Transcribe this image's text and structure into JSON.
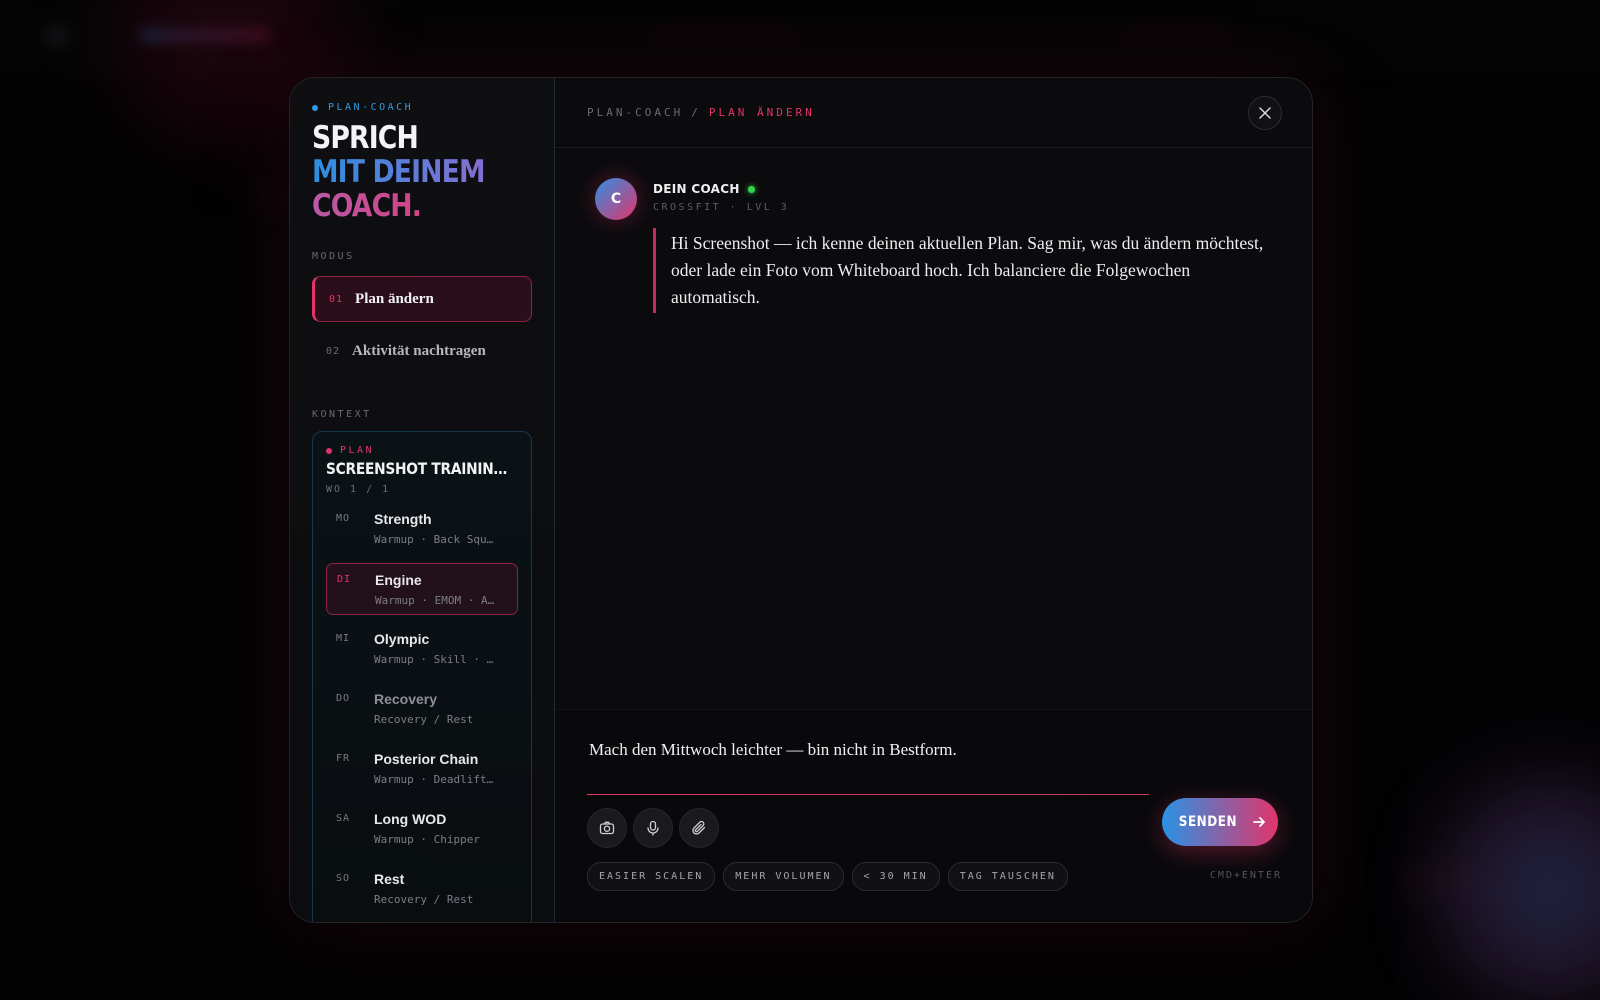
{
  "modal": {
    "eyebrow": "PLAN-COACH",
    "headline": {
      "line1": "SPRICH",
      "line2": "MIT DEINEM",
      "line3": "COACH."
    },
    "modus_label": "MODUS",
    "modes": [
      {
        "num": "01",
        "label": "Plan ändern",
        "active": true
      },
      {
        "num": "02",
        "label": "Aktivität nachtragen",
        "active": false
      }
    ],
    "kontext_label": "KONTEXT",
    "context": {
      "tag": "PLAN",
      "title": "SCREENSHOT TRAININGSPL...",
      "week": "WO 1 / 1",
      "days": [
        {
          "code": "MO",
          "name": "Strength",
          "sub": "Warmup · Back Squ…"
        },
        {
          "code": "DI",
          "name": "Engine",
          "sub": "Warmup · EMOM · A…"
        },
        {
          "code": "MI",
          "name": "Olympic",
          "sub": "Warmup · Skill · …"
        },
        {
          "code": "DO",
          "name": "Recovery",
          "sub": "Recovery / Rest"
        },
        {
          "code": "FR",
          "name": "Posterior Chain",
          "sub": "Warmup · Deadlift…"
        },
        {
          "code": "SA",
          "name": "Long WOD",
          "sub": "Warmup · Chipper"
        },
        {
          "code": "SO",
          "name": "Rest",
          "sub": "Recovery / Rest"
        }
      ]
    },
    "breadcrumb": {
      "root": "PLAN-COACH",
      "separator": "/",
      "current": "PLAN ÄNDERN"
    },
    "coach": {
      "avatar_letter": "C",
      "name": "DEIN COACH",
      "subtitle": "CROSSFIT · LVL 3",
      "message": "Hi Screenshot — ich kenne deinen aktuellen Plan. Sag mir, was du ändern möchtest, oder lade ein Foto vom Whiteboard hoch. Ich balanciere die Folgewochen automatisch."
    },
    "composer": {
      "input_value": "Mach den Mittwoch leichter — bin nicht in Bestform.",
      "send_label": "SENDEN",
      "chips": [
        "EASIER SCALEN",
        "MEHR VOLUMEN",
        "< 30 MIN",
        "TAG TAUSCHEN"
      ],
      "shortcut_hint": "CMD+ENTER"
    }
  },
  "colors": {
    "accent_pink": "#e2346a",
    "accent_blue": "#2f8fe4",
    "online": "#34d44e"
  },
  "icons": [
    "close-icon",
    "camera-icon",
    "microphone-icon",
    "paperclip-icon",
    "arrow-right-icon"
  ]
}
